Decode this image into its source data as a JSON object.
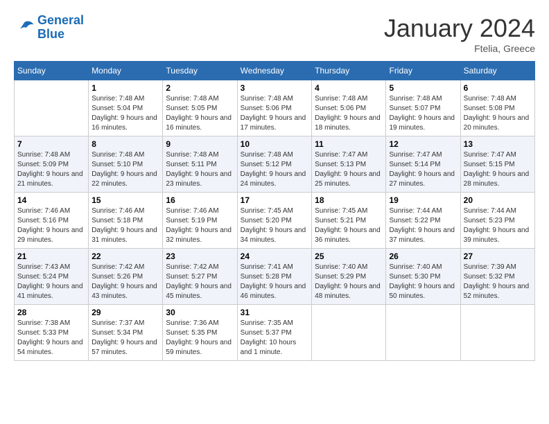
{
  "header": {
    "logo_line1": "General",
    "logo_line2": "Blue",
    "title": "January 2024",
    "subtitle": "Ftelia, Greece"
  },
  "columns": [
    "Sunday",
    "Monday",
    "Tuesday",
    "Wednesday",
    "Thursday",
    "Friday",
    "Saturday"
  ],
  "weeks": [
    [
      {
        "day": "",
        "sunrise": "",
        "sunset": "",
        "daylight": ""
      },
      {
        "day": "1",
        "sunrise": "Sunrise: 7:48 AM",
        "sunset": "Sunset: 5:04 PM",
        "daylight": "Daylight: 9 hours and 16 minutes."
      },
      {
        "day": "2",
        "sunrise": "Sunrise: 7:48 AM",
        "sunset": "Sunset: 5:05 PM",
        "daylight": "Daylight: 9 hours and 16 minutes."
      },
      {
        "day": "3",
        "sunrise": "Sunrise: 7:48 AM",
        "sunset": "Sunset: 5:06 PM",
        "daylight": "Daylight: 9 hours and 17 minutes."
      },
      {
        "day": "4",
        "sunrise": "Sunrise: 7:48 AM",
        "sunset": "Sunset: 5:06 PM",
        "daylight": "Daylight: 9 hours and 18 minutes."
      },
      {
        "day": "5",
        "sunrise": "Sunrise: 7:48 AM",
        "sunset": "Sunset: 5:07 PM",
        "daylight": "Daylight: 9 hours and 19 minutes."
      },
      {
        "day": "6",
        "sunrise": "Sunrise: 7:48 AM",
        "sunset": "Sunset: 5:08 PM",
        "daylight": "Daylight: 9 hours and 20 minutes."
      }
    ],
    [
      {
        "day": "7",
        "sunrise": "Sunrise: 7:48 AM",
        "sunset": "Sunset: 5:09 PM",
        "daylight": "Daylight: 9 hours and 21 minutes."
      },
      {
        "day": "8",
        "sunrise": "Sunrise: 7:48 AM",
        "sunset": "Sunset: 5:10 PM",
        "daylight": "Daylight: 9 hours and 22 minutes."
      },
      {
        "day": "9",
        "sunrise": "Sunrise: 7:48 AM",
        "sunset": "Sunset: 5:11 PM",
        "daylight": "Daylight: 9 hours and 23 minutes."
      },
      {
        "day": "10",
        "sunrise": "Sunrise: 7:48 AM",
        "sunset": "Sunset: 5:12 PM",
        "daylight": "Daylight: 9 hours and 24 minutes."
      },
      {
        "day": "11",
        "sunrise": "Sunrise: 7:47 AM",
        "sunset": "Sunset: 5:13 PM",
        "daylight": "Daylight: 9 hours and 25 minutes."
      },
      {
        "day": "12",
        "sunrise": "Sunrise: 7:47 AM",
        "sunset": "Sunset: 5:14 PM",
        "daylight": "Daylight: 9 hours and 27 minutes."
      },
      {
        "day": "13",
        "sunrise": "Sunrise: 7:47 AM",
        "sunset": "Sunset: 5:15 PM",
        "daylight": "Daylight: 9 hours and 28 minutes."
      }
    ],
    [
      {
        "day": "14",
        "sunrise": "Sunrise: 7:46 AM",
        "sunset": "Sunset: 5:16 PM",
        "daylight": "Daylight: 9 hours and 29 minutes."
      },
      {
        "day": "15",
        "sunrise": "Sunrise: 7:46 AM",
        "sunset": "Sunset: 5:18 PM",
        "daylight": "Daylight: 9 hours and 31 minutes."
      },
      {
        "day": "16",
        "sunrise": "Sunrise: 7:46 AM",
        "sunset": "Sunset: 5:19 PM",
        "daylight": "Daylight: 9 hours and 32 minutes."
      },
      {
        "day": "17",
        "sunrise": "Sunrise: 7:45 AM",
        "sunset": "Sunset: 5:20 PM",
        "daylight": "Daylight: 9 hours and 34 minutes."
      },
      {
        "day": "18",
        "sunrise": "Sunrise: 7:45 AM",
        "sunset": "Sunset: 5:21 PM",
        "daylight": "Daylight: 9 hours and 36 minutes."
      },
      {
        "day": "19",
        "sunrise": "Sunrise: 7:44 AM",
        "sunset": "Sunset: 5:22 PM",
        "daylight": "Daylight: 9 hours and 37 minutes."
      },
      {
        "day": "20",
        "sunrise": "Sunrise: 7:44 AM",
        "sunset": "Sunset: 5:23 PM",
        "daylight": "Daylight: 9 hours and 39 minutes."
      }
    ],
    [
      {
        "day": "21",
        "sunrise": "Sunrise: 7:43 AM",
        "sunset": "Sunset: 5:24 PM",
        "daylight": "Daylight: 9 hours and 41 minutes."
      },
      {
        "day": "22",
        "sunrise": "Sunrise: 7:42 AM",
        "sunset": "Sunset: 5:26 PM",
        "daylight": "Daylight: 9 hours and 43 minutes."
      },
      {
        "day": "23",
        "sunrise": "Sunrise: 7:42 AM",
        "sunset": "Sunset: 5:27 PM",
        "daylight": "Daylight: 9 hours and 45 minutes."
      },
      {
        "day": "24",
        "sunrise": "Sunrise: 7:41 AM",
        "sunset": "Sunset: 5:28 PM",
        "daylight": "Daylight: 9 hours and 46 minutes."
      },
      {
        "day": "25",
        "sunrise": "Sunrise: 7:40 AM",
        "sunset": "Sunset: 5:29 PM",
        "daylight": "Daylight: 9 hours and 48 minutes."
      },
      {
        "day": "26",
        "sunrise": "Sunrise: 7:40 AM",
        "sunset": "Sunset: 5:30 PM",
        "daylight": "Daylight: 9 hours and 50 minutes."
      },
      {
        "day": "27",
        "sunrise": "Sunrise: 7:39 AM",
        "sunset": "Sunset: 5:32 PM",
        "daylight": "Daylight: 9 hours and 52 minutes."
      }
    ],
    [
      {
        "day": "28",
        "sunrise": "Sunrise: 7:38 AM",
        "sunset": "Sunset: 5:33 PM",
        "daylight": "Daylight: 9 hours and 54 minutes."
      },
      {
        "day": "29",
        "sunrise": "Sunrise: 7:37 AM",
        "sunset": "Sunset: 5:34 PM",
        "daylight": "Daylight: 9 hours and 57 minutes."
      },
      {
        "day": "30",
        "sunrise": "Sunrise: 7:36 AM",
        "sunset": "Sunset: 5:35 PM",
        "daylight": "Daylight: 9 hours and 59 minutes."
      },
      {
        "day": "31",
        "sunrise": "Sunrise: 7:35 AM",
        "sunset": "Sunset: 5:37 PM",
        "daylight": "Daylight: 10 hours and 1 minute."
      },
      {
        "day": "",
        "sunrise": "",
        "sunset": "",
        "daylight": ""
      },
      {
        "day": "",
        "sunrise": "",
        "sunset": "",
        "daylight": ""
      },
      {
        "day": "",
        "sunrise": "",
        "sunset": "",
        "daylight": ""
      }
    ]
  ]
}
